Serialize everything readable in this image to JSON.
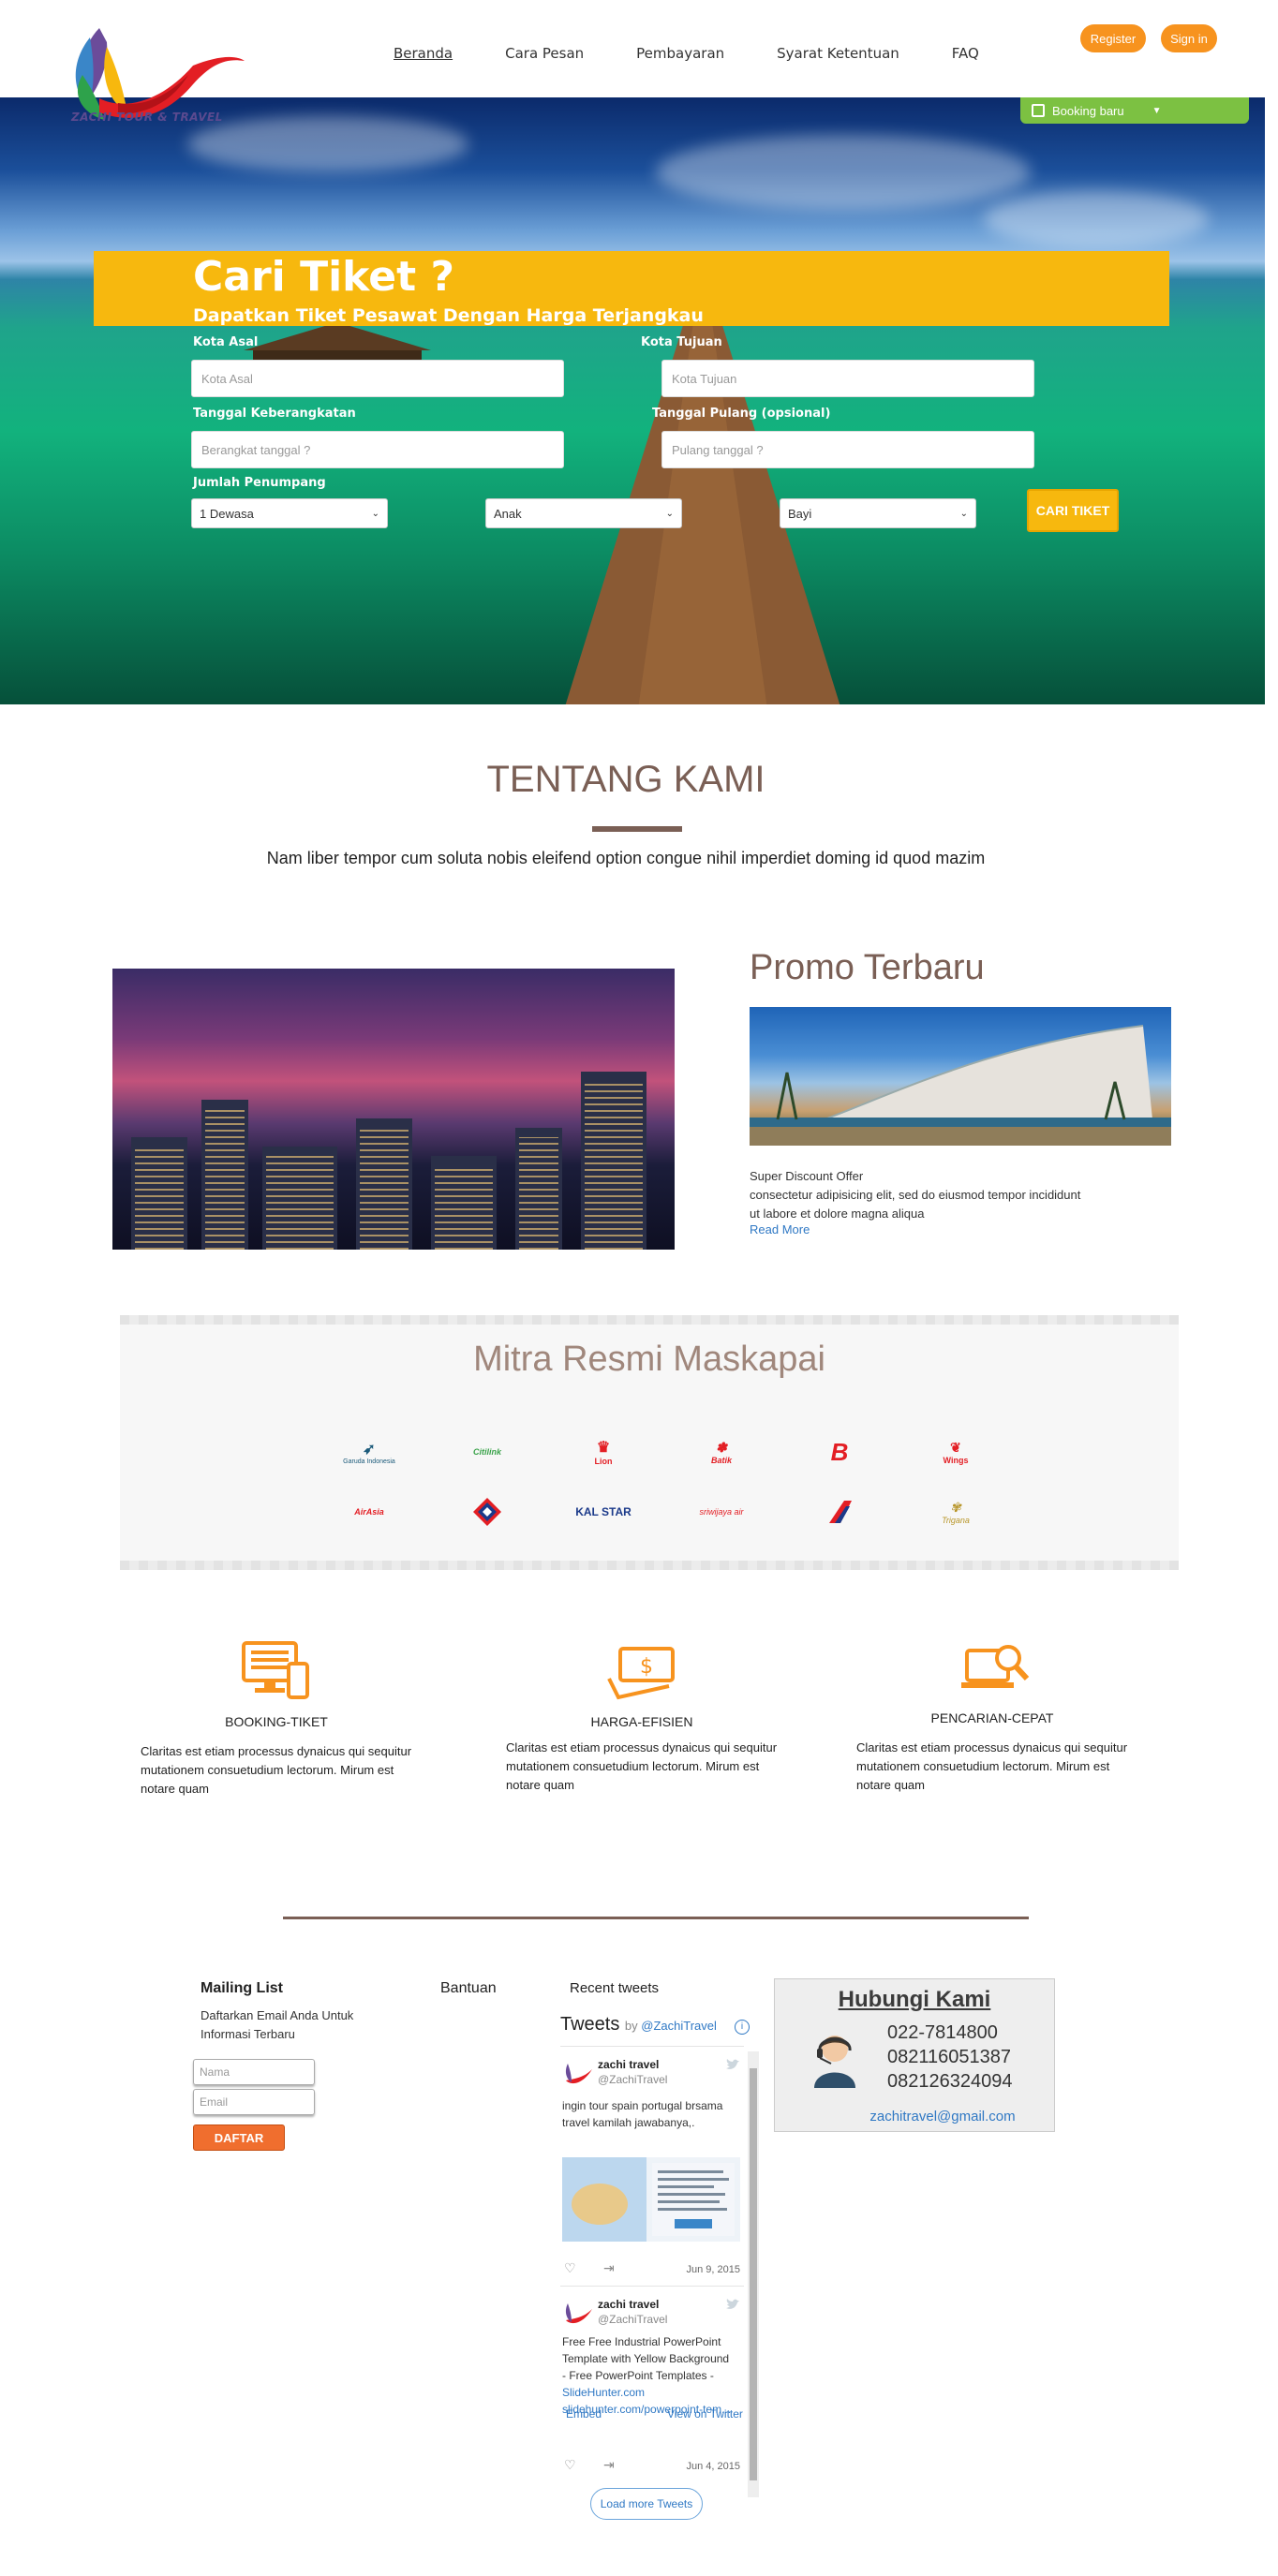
{
  "header": {
    "logo_text": "ZACHI TOUR & TRAVEL",
    "nav": [
      "Beranda",
      "Cara Pesan",
      "Pembayaran",
      "Syarat Ketentuan",
      "FAQ"
    ],
    "register": "Register",
    "signin": "Sign in",
    "booking_tab": "Booking baru"
  },
  "search": {
    "title": "Cari Tiket ?",
    "subtitle": "Dapatkan Tiket Pesawat Dengan Harga Terjangkau",
    "from_label": "Kota Asal",
    "from_placeholder": "Kota Asal",
    "to_label": "Kota Tujuan",
    "to_placeholder": "Kota Tujuan",
    "depart_label": "Tanggal Keberangkatan",
    "depart_placeholder": "Berangkat tanggal ?",
    "return_label": "Tanggal Pulang (opsional)",
    "return_placeholder": "Pulang tanggal ?",
    "pax_label": "Jumlah Penumpang",
    "adult": "1 Dewasa",
    "child": "Anak",
    "infant": "Bayi",
    "submit": "CARI TIKET"
  },
  "about": {
    "title": "TENTANG KAMI",
    "text": "Nam liber tempor cum soluta nobis eleifend option congue nihil imperdiet doming id quod mazim"
  },
  "promo": {
    "title": "Promo Terbaru",
    "heading": "Super Discount Offer",
    "line1": "consectetur adipisicing elit, sed do eiusmod tempor incididunt",
    "line2": "ut labore et dolore magna aliqua",
    "link": "Read More"
  },
  "mitra": {
    "title": "Mitra Resmi Maskapai",
    "airlines": [
      "Garuda Indonesia",
      "Citilink",
      "Lion",
      "Batik",
      "B",
      "Wings",
      "AirAsia",
      "",
      "KAL STAR",
      "sriwijaya air",
      "",
      "Trigana"
    ]
  },
  "features": [
    {
      "title": "BOOKING-TIKET",
      "text": "Claritas est etiam processus dynaicus qui sequitur mutationem consuetudium lectorum. Mirum est notare quam"
    },
    {
      "title": "HARGA-EFISIEN",
      "text": "Claritas est etiam processus dynaicus qui sequitur mutationem consuetudium lectorum. Mirum est notare quam"
    },
    {
      "title": "PENCARIAN-CEPAT",
      "text": "Claritas est etiam processus dynaicus qui sequitur mutationem consuetudium lectorum. Mirum est notare quam"
    }
  ],
  "footer": {
    "mailing_title": "Mailing  List",
    "mailing_text1": "Daftarkan Email Anda Untuk",
    "mailing_text2": "Informasi Terbaru",
    "name_placeholder": "Nama",
    "email_placeholder": "Email",
    "subscribe": "DAFTAR",
    "bantuan": "Bantuan",
    "recent_tweets": "Recent tweets",
    "embed": "Embed",
    "view_twitter": "View on Twitter"
  },
  "twitter": {
    "title": "Tweets",
    "by": "by",
    "handle_link": "@ZachiTravel",
    "load_more": "Load more Tweets",
    "tweets": [
      {
        "name": "zachi travel",
        "handle": "@ZachiTravel",
        "text1": "ingin tour spain portugal brsama",
        "text2": "travel kamilah jawabanya,.",
        "date": "Jun 9, 2015"
      },
      {
        "name": "zachi travel",
        "handle": "@ZachiTravel",
        "text1": "Free Free Industrial PowerPoint",
        "text2": "Template with Yellow Background",
        "text3": "- Free PowerPoint Templates -",
        "link1": "SlideHunter.com",
        "link2": "slidehunter.com/powerpoint-tem...",
        "date": "Jun 4, 2015"
      }
    ]
  },
  "contact": {
    "title": "Hubungi Kami",
    "phones": [
      "022-7814800",
      "082116051387",
      "082126324094"
    ],
    "email": "zachitravel@gmail.com"
  }
}
